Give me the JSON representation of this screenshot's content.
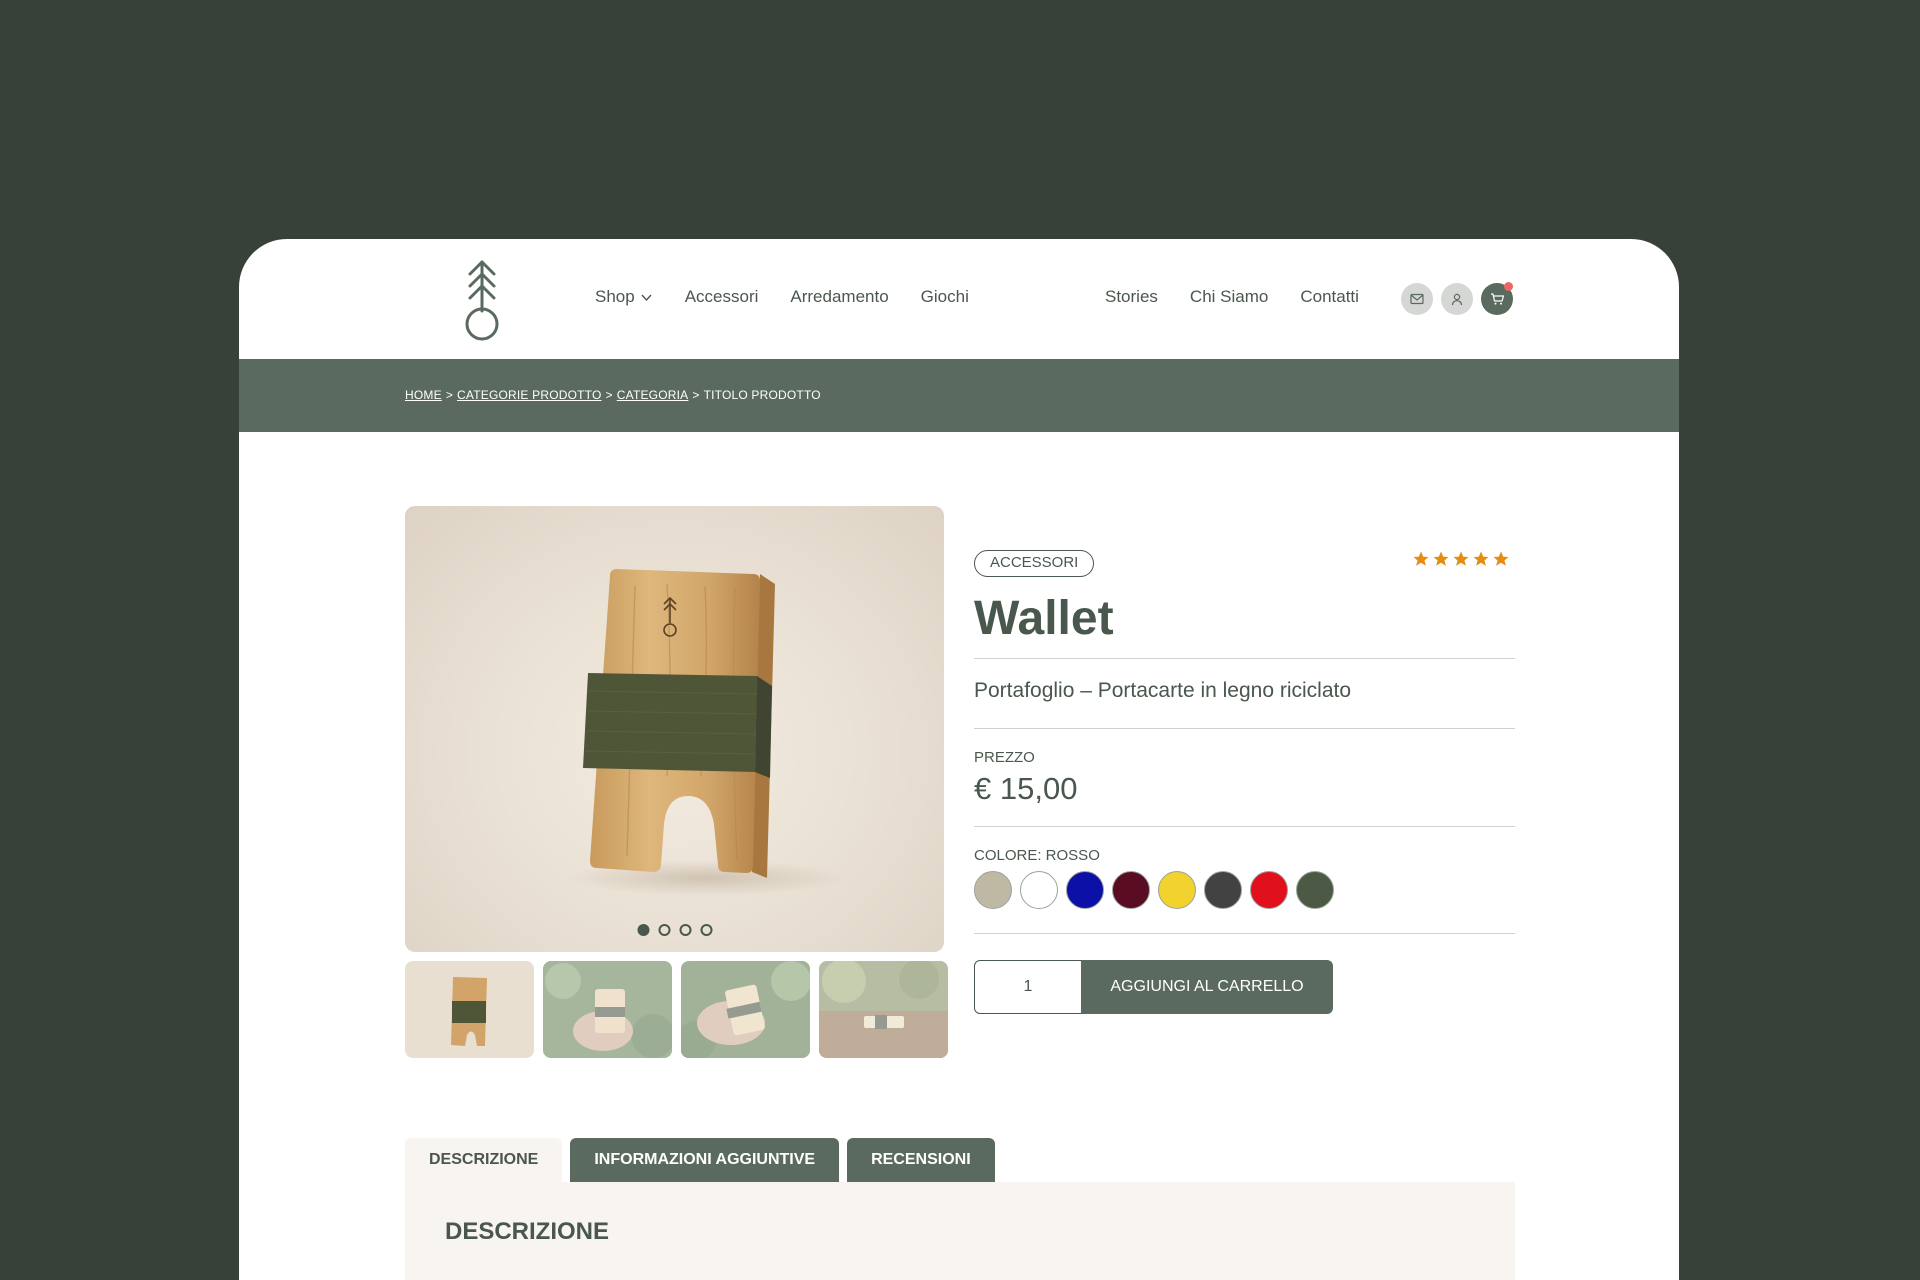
{
  "nav": {
    "shop": "Shop",
    "accessori": "Accessori",
    "arredamento": "Arredamento",
    "giochi": "Giochi",
    "stories": "Stories",
    "chi_siamo": "Chi Siamo",
    "contatti": "Contatti"
  },
  "header_icons": [
    "mail-icon",
    "user-icon",
    "cart-icon"
  ],
  "breadcrumb": {
    "home": "HOME",
    "categorie": "CATEGORIE PRODOTTO",
    "categoria": "CATEGORIA",
    "current": "TITOLO PRODOTTO",
    "separator": ">"
  },
  "gallery": {
    "active_slide": 1,
    "slide_count": 4
  },
  "product": {
    "category_badge": "ACCESSORI",
    "rating": 5,
    "rating_max": 5,
    "title": "Wallet",
    "subtitle": "Portafoglio – Portacarte in legno riciclato",
    "price_label": "PREZZO",
    "price": "€ 15,00",
    "color_label": "COLORE: ROSSO",
    "swatches": [
      "#bfb9a4",
      "#ffffff",
      "#0c10a6",
      "#5a0c22",
      "#f2d22c",
      "#424242",
      "#e0101c",
      "#4c5a45"
    ],
    "quantity": "1",
    "add_to_cart": "AGGIUNGI AL CARRELLO"
  },
  "tabs": {
    "descrizione": "DESCRIZIONE",
    "info": "INFORMAZIONI AGGIUNTIVE",
    "recensioni": "RECENSIONI",
    "panel_title": "DESCRIZIONE"
  },
  "colors": {
    "background": "#374139",
    "brand": "#5b6a5e",
    "text": "#4a574d",
    "star": "#e48c13",
    "cart_dot": "#ef6464"
  }
}
